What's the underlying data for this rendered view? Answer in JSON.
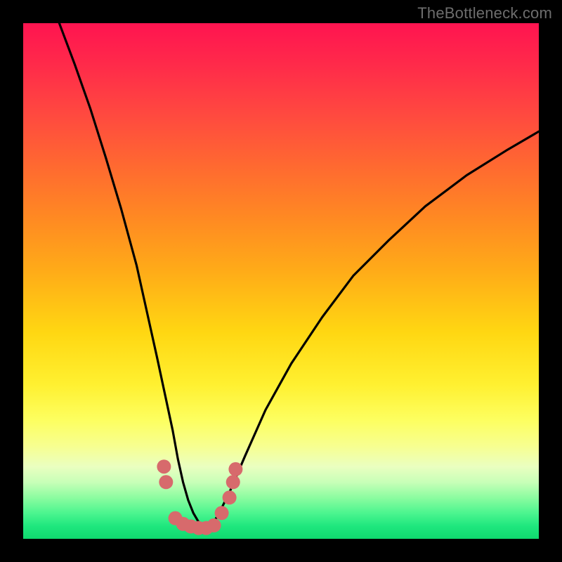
{
  "watermark": "TheBottleneck.com",
  "chart_data": {
    "type": "line",
    "title": "",
    "xlabel": "",
    "ylabel": "",
    "ylim": [
      0,
      100
    ],
    "xlim": [
      0,
      100
    ],
    "series": [
      {
        "name": "bottleneck-curve",
        "x": [
          7,
          10,
          13,
          16,
          19,
          22,
          24,
          26,
          27.5,
          29,
          30,
          31,
          32,
          33,
          34,
          35,
          36,
          37,
          38,
          40,
          43,
          47,
          52,
          58,
          64,
          71,
          78,
          86,
          94,
          100
        ],
        "values": [
          100,
          92,
          83.5,
          74,
          64,
          53,
          44,
          35,
          28,
          21,
          15.5,
          11,
          7.5,
          5,
          3.3,
          2.3,
          2.3,
          3.3,
          5,
          9,
          16,
          25,
          34,
          43,
          51,
          58,
          64.5,
          70.5,
          75.5,
          79
        ]
      }
    ],
    "markers": {
      "name": "bottleneck-markers",
      "color": "#d76a6c",
      "radius_px": 10,
      "points": [
        {
          "x": 27.3,
          "y": 14.0
        },
        {
          "x": 27.7,
          "y": 11.0
        },
        {
          "x": 29.5,
          "y": 4.0
        },
        {
          "x": 31.0,
          "y": 2.9
        },
        {
          "x": 32.5,
          "y": 2.4
        },
        {
          "x": 34.0,
          "y": 2.1
        },
        {
          "x": 35.5,
          "y": 2.1
        },
        {
          "x": 37.0,
          "y": 2.6
        },
        {
          "x": 38.5,
          "y": 5.0
        },
        {
          "x": 40.0,
          "y": 8.0
        },
        {
          "x": 40.7,
          "y": 11.0
        },
        {
          "x": 41.2,
          "y": 13.5
        }
      ]
    },
    "gradient_stops": [
      {
        "pos": 0.0,
        "color": "#ff1450"
      },
      {
        "pos": 0.5,
        "color": "#ffc515"
      },
      {
        "pos": 0.82,
        "color": "#f5ff90"
      },
      {
        "pos": 1.0,
        "color": "#0fd86e"
      }
    ]
  }
}
